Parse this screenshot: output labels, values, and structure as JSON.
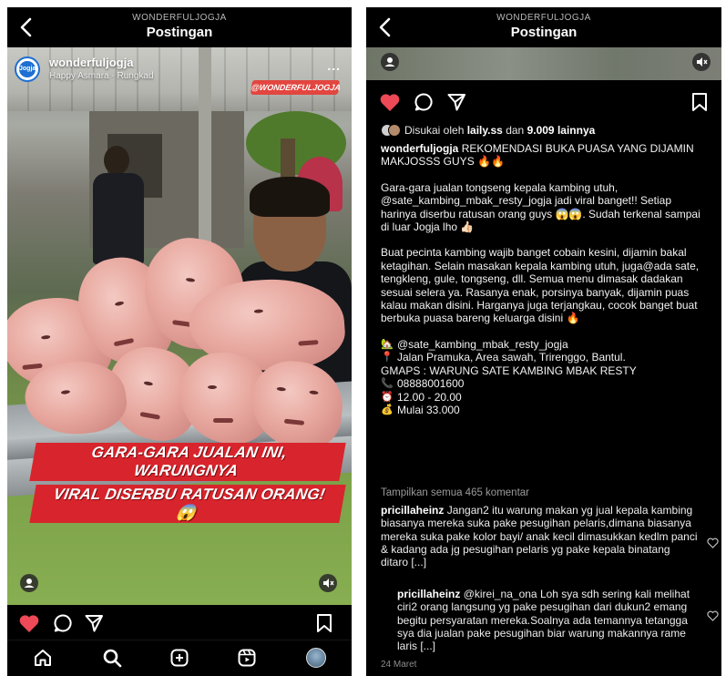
{
  "left": {
    "header": {
      "account": "WONDERFULJOGJA",
      "title": "Postingan"
    },
    "post": {
      "username": "wonderfuljogja",
      "location": "Happy Asmara · Rungkad",
      "avatar_text": "Jogja",
      "watermark": "@WONDERFULJOGJA",
      "overlay_line1": "GARA-GARA JUALAN INI, WARUNGNYA",
      "overlay_line2": "VIRAL DISERBU RATUSAN ORANG! 😱",
      "more_label": "..."
    }
  },
  "right": {
    "header": {
      "account": "WONDERFULJOGJA",
      "title": "Postingan"
    },
    "liked": {
      "prefix": "Disukai oleh",
      "user": "laily.ss",
      "middle": "dan",
      "count": "9.009 lainnya"
    },
    "caption": {
      "username": "wonderfuljogja",
      "headline": "REKOMENDASI BUKA PUASA YANG DIJAMIN MAKJOSSS GUYS 🔥🔥",
      "para1": "Gara-gara jualan tongseng kepala kambing utuh, @sate_kambing_mbak_resty_jogja jadi viral banget!! Setiap harinya diserbu ratusan orang guys 😱😱. Sudah terkenal sampai di luar Jogja lho 👍🏻",
      "para2": "Buat pecinta kambing wajib banget cobain kesini, dijamin bakal ketagihan. Selain masakan kepala kambing utuh, juga@ada sate, tengkleng, gule, tongseng, dll. Semua menu dimasak dadakan sesuai selera ya. Rasanya enak, porsinya banyak, dijamin puas kalau makan disini. Harganya juga terjangkau, cocok banget buat berbuka puasa bareng keluarga disini 🔥",
      "details": [
        {
          "icon": "🏡",
          "text": "@sate_kambing_mbak_resty_jogja"
        },
        {
          "icon": "📍",
          "text": "Jalan Pramuka, Area sawah, Trirenggo, Bantul."
        },
        {
          "icon": "",
          "text": "GMAPS : WARUNG SATE KAMBING MBAK RESTY"
        },
        {
          "icon": "📞",
          "text": "08888001600"
        },
        {
          "icon": "⏰",
          "text": "12.00 - 20.00"
        },
        {
          "icon": "💰",
          "text": "Mulai 33.000"
        }
      ]
    },
    "view_all": "Tampilkan semua 465 komentar",
    "comments": [
      {
        "user": "pricillaheinz",
        "text": "Jangan2 itu warung makan yg jual kepala kambing biasanya mereka suka pake pesugihan pelaris,dimana biasanya mereka suka pake kolor bayi/ anak kecil dimasukkan kedlm panci & kadang ada jg pesugihan pelaris yg pake kepala binatang ditaro [...]"
      },
      {
        "user": "pricillaheinz",
        "text": "@kirei_na_ona Loh sya sdh sering kali melihat ciri2 orang langsung yg pake pesugihan dari dukun2 emang begitu persyaratan mereka.Soalnya ada temannya tetangga sya dia jualan pake pesugihan biar warung makannya rame laris [...]"
      }
    ],
    "date": "24 Maret"
  },
  "colors": {
    "like_red": "#ed4956",
    "background": "#000000",
    "text": "#ffffff",
    "muted": "#9a9a9a"
  },
  "icons": [
    "back-arrow-icon",
    "heart-icon",
    "comment-icon",
    "share-icon",
    "bookmark-icon",
    "home-icon",
    "search-icon",
    "create-icon",
    "reels-icon",
    "profile-avatar",
    "mute-icon",
    "user-tag-icon"
  ]
}
